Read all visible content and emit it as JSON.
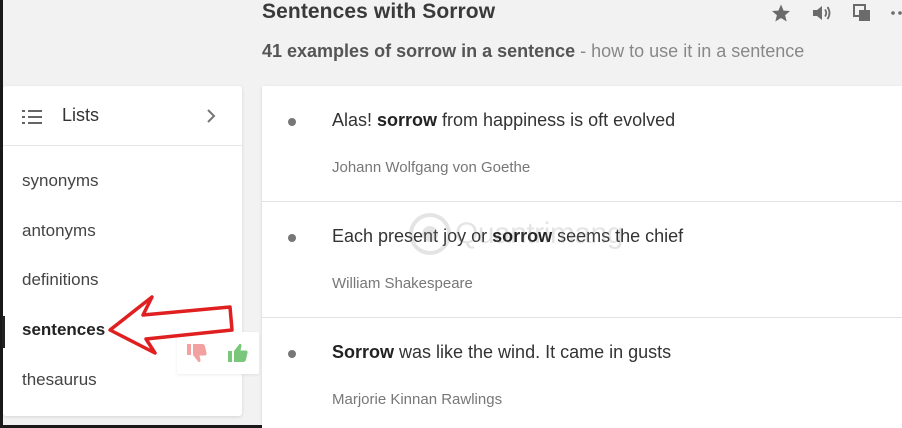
{
  "page": {
    "title": "Sentences with Sorrow",
    "subtitle_strong": "41 examples of sorrow in a sentence",
    "subtitle_rest": " - how to use it in a sentence"
  },
  "header_icons": [
    "star-icon",
    "speaker-icon",
    "copy-icon",
    "more-icon"
  ],
  "sidebar": {
    "title": "Lists",
    "items": [
      {
        "label": "synonyms"
      },
      {
        "label": "antonyms"
      },
      {
        "label": "definitions"
      },
      {
        "label": "sentences",
        "active": true
      },
      {
        "label": "thesaurus"
      }
    ]
  },
  "sentences": [
    {
      "pre": "Alas! ",
      "strong": "sorrow",
      "post": " from happiness is oft evolved",
      "author": "Johann Wolfgang von Goethe"
    },
    {
      "pre": "Each present joy or ",
      "strong": "sorrow",
      "post": " seems the chief",
      "author": "William Shakespeare"
    },
    {
      "pre": "",
      "strong": "Sorrow",
      "post": " was like the wind. It came in gusts",
      "author": "Marjorie Kinnan Rawlings"
    }
  ],
  "watermark": {
    "text": "Quantrimang"
  },
  "colors": {
    "annotation": "#e02020",
    "thumb_down": "#f2a0a0",
    "thumb_up": "#7ac67a",
    "muted_icon": "#6b6b6b"
  }
}
